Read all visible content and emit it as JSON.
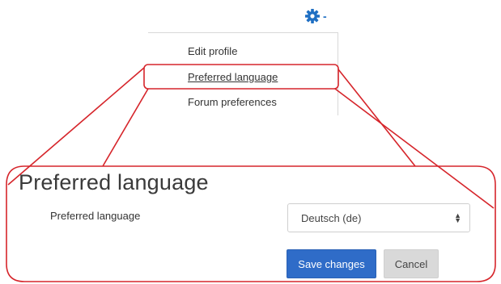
{
  "user_menu": {
    "toggle_icon": "gear-icon",
    "toggle_caret_icon": "caret-down-icon",
    "items": [
      {
        "label": "Edit profile"
      },
      {
        "label": "Preferred language"
      },
      {
        "label": "Forum preferences"
      }
    ],
    "highlighted_index": 1
  },
  "callout": {
    "color": "#d6252b"
  },
  "form": {
    "heading": "Preferred language",
    "field_label": "Preferred language",
    "selected_language": "Deutsch (de)",
    "save_label": "Save changes",
    "cancel_label": "Cancel"
  },
  "colors": {
    "accent": "#1f6fc3",
    "primary_button": "#2f6cc8",
    "secondary_button": "#d9d9d9",
    "callout": "#d6252b"
  }
}
